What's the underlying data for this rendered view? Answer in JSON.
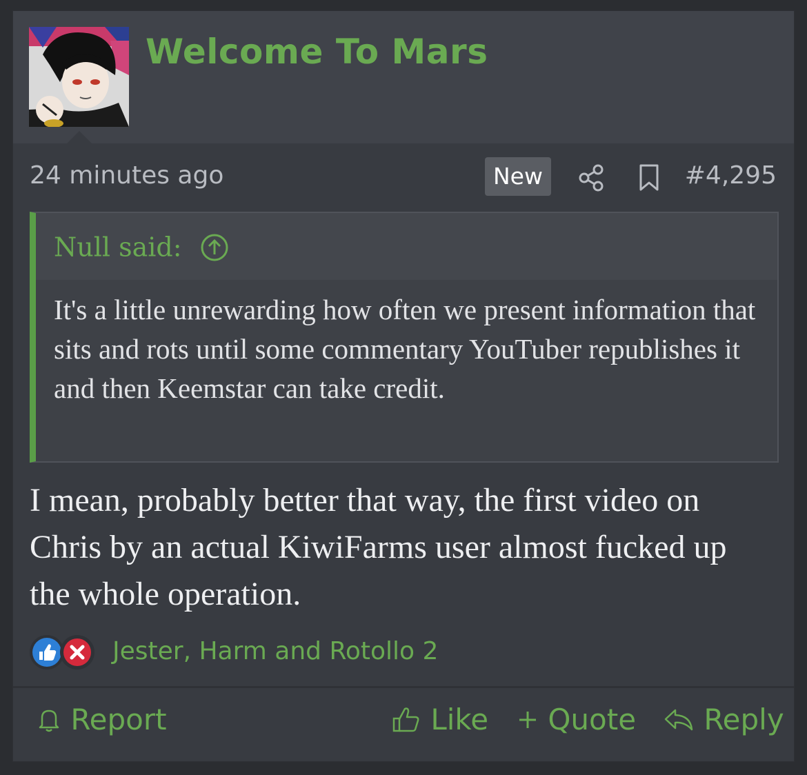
{
  "post": {
    "author": "Welcome To Mars",
    "time": "24 minutes ago",
    "badge": "New",
    "number": "#4,295",
    "quote": {
      "author": "Null said:",
      "text": "It's a little unrewarding how often we present information that sits and rots until some commentary YouTuber republishes it and then Keemstar can take credit."
    },
    "message": "I mean, probably better that way, the first video on Chris by an actual KiwiFarms user almost fucked up the whole operation.",
    "reactions": {
      "icons": [
        "like-reaction-icon",
        "dumb-reaction-icon"
      ],
      "names": "Jester, Harm and Rotollo 2"
    },
    "actions": {
      "report": "Report",
      "like": "Like",
      "quote": "Quote",
      "reply": "Reply"
    }
  },
  "colors": {
    "accent_green": "#6aaa52",
    "quote_bar": "#5a9e48",
    "background": "#383b41"
  }
}
